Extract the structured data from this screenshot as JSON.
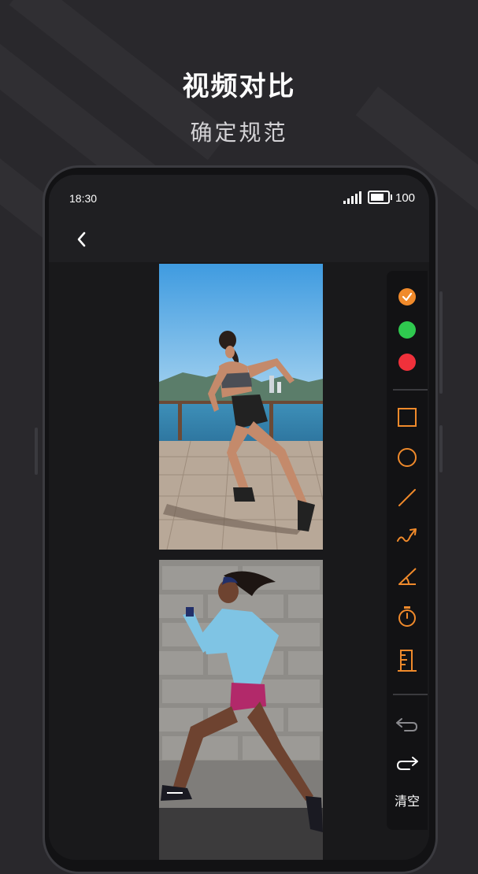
{
  "promo": {
    "title": "视频对比",
    "subtitle": "确定规范"
  },
  "status_bar": {
    "time": "18:30",
    "battery": "100"
  },
  "nav": {
    "back_icon": "chevron-left-icon"
  },
  "toolbar": {
    "colors": [
      "#f08a2b",
      "#2fc94f",
      "#f0313b"
    ],
    "selected_color": "#f08a2b",
    "accent": "#f08a2b",
    "tools": [
      "rectangle-icon",
      "circle-icon",
      "line-icon",
      "curve-arrow-icon",
      "angle-icon",
      "stopwatch-icon",
      "ruler-icon"
    ],
    "undo_icon": "undo-icon",
    "redo_icon": "redo-icon",
    "clear_label": "清空"
  },
  "videos": [
    "running-woman-boardwalk",
    "sprinting-woman-wall"
  ]
}
